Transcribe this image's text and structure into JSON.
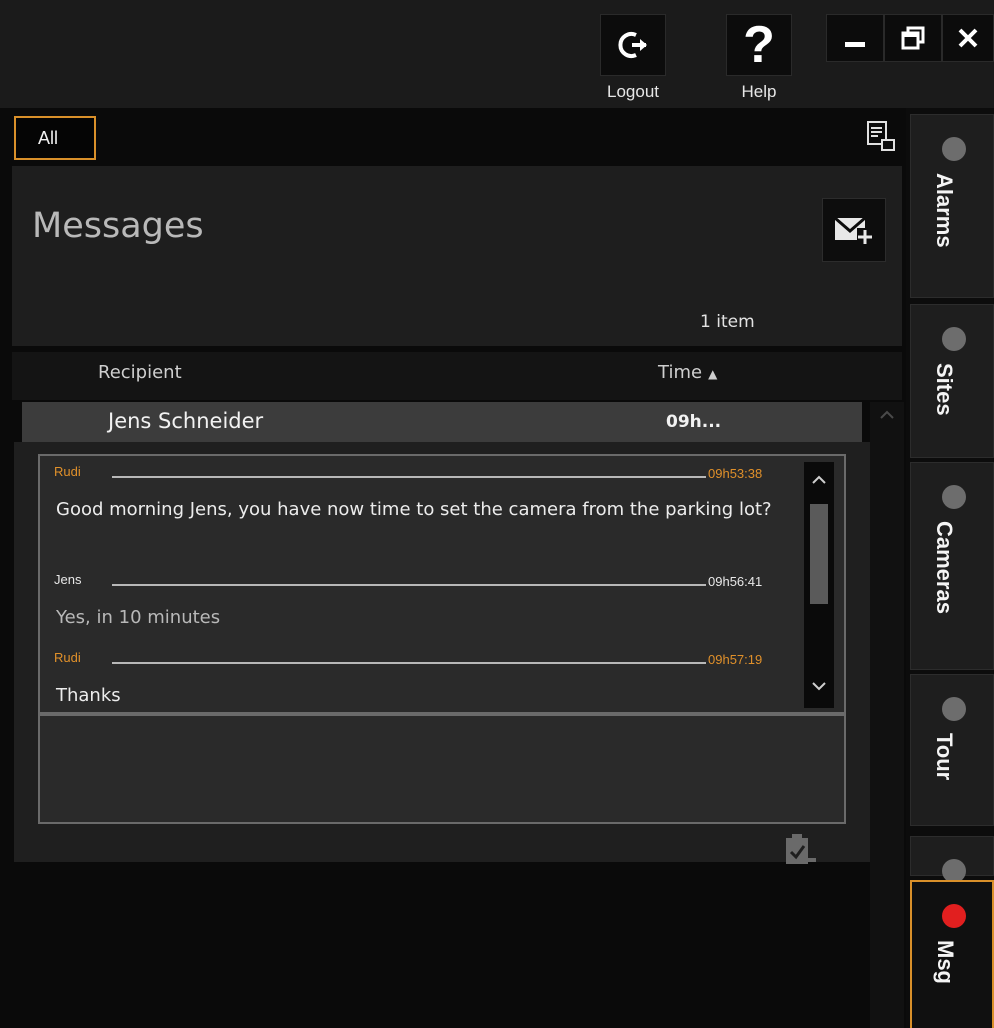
{
  "toolbar": {
    "logout_label": "Logout",
    "help_label": "Help"
  },
  "filter": {
    "all_label": "All"
  },
  "messages": {
    "title": "Messages",
    "item_count": "1 item",
    "columns": {
      "recipient": "Recipient",
      "time": "Time"
    },
    "rows": [
      {
        "recipient": "Jens Schneider",
        "time": "09h..."
      }
    ]
  },
  "conversation": [
    {
      "sender": "Rudi",
      "time": "09h53:38",
      "text": "Good morning Jens, you have now time to set the camera from the parking lot?",
      "sender_color": "#e0902a"
    },
    {
      "sender": "Jens",
      "time": "09h56:41",
      "text": "Yes, in 10 minutes",
      "sender_color": "#e8e8e8"
    },
    {
      "sender": "Rudi",
      "time": "09h57:19",
      "text": "Thanks",
      "sender_color": "#e0902a"
    }
  ],
  "side_tabs": {
    "alarms": "Alarms",
    "sites": "Sites",
    "cameras": "Cameras",
    "tour": "Tour",
    "msg": "Msg"
  },
  "colors": {
    "accent": "#d9902a",
    "alert_dot": "#e11f1f",
    "idle_dot": "#6d6d6d"
  }
}
